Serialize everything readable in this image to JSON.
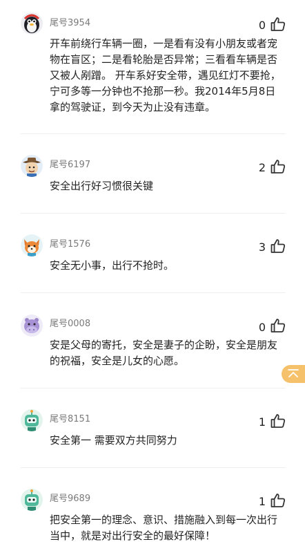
{
  "comments": [
    {
      "user": "尾号3954",
      "likes": "0",
      "text": "开车前绕行车辆一圈，一是看有没有小朋友或者宠物在盲区；二是看轮胎是否异常；三看看车辆是否又被人剐蹭。 开车系好安全带，遇见红灯不要抢，宁可多等一分钟也不抢那一秒。我2014年5月8日拿的驾驶证，到今天为止没有违章。",
      "avatar": "penguin-avatar"
    },
    {
      "user": "尾号6197",
      "likes": "2",
      "text": "安全出行好习惯很关键",
      "avatar": "cowboy-avatar"
    },
    {
      "user": "尾号1576",
      "likes": "3",
      "text": "安全无小事，出行不抢时。",
      "avatar": "fox-avatar"
    },
    {
      "user": "尾号0008",
      "likes": "0",
      "text": "安是父母的寄托，安全是妻子的企盼，安全是朋友的祝福，安全是儿女的心愿。",
      "avatar": "hippo-avatar"
    },
    {
      "user": "尾号8151",
      "likes": "1",
      "text": "安全第一 需要双方共同努力",
      "avatar": "robot-avatar"
    },
    {
      "user": "尾号9689",
      "likes": "1",
      "text": "把安全第一的理念、意识、措施融入到每一次出行当中，就是对出行安全的最好保障！",
      "avatar": "robot-avatar"
    }
  ],
  "icons": {
    "like": "thumbs-up-icon",
    "float_tab": "back-to-top-icon"
  },
  "colors": {
    "username": "#7a7a7a",
    "text": "#222222",
    "divider": "#eeeeee",
    "float_tab": "#f5c26b"
  }
}
